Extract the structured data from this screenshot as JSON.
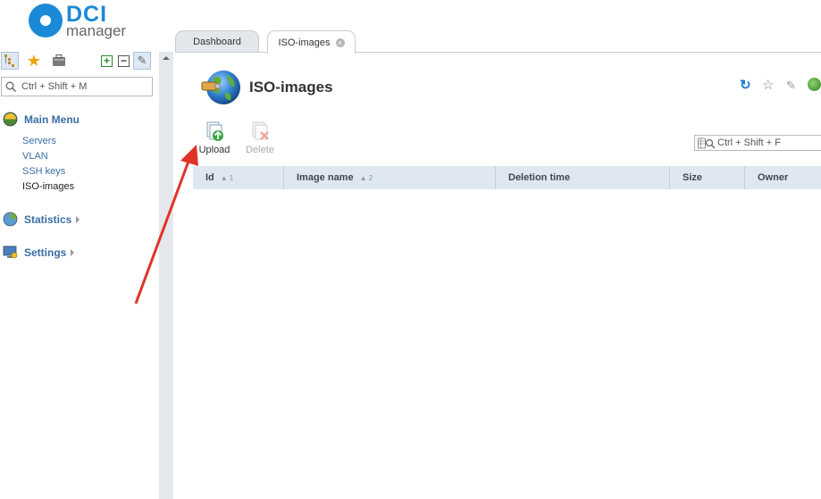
{
  "logo": {
    "brand": "DCI",
    "product": "manager"
  },
  "left_panel": {
    "search_placeholder": "Ctrl + Shift + M",
    "main_menu": {
      "label": "Main Menu",
      "items": [
        "Servers",
        "VLAN",
        "SSH keys",
        "ISO-images"
      ]
    },
    "statistics_label": "Statistics",
    "settings_label": "Settings"
  },
  "tabs": [
    {
      "label": "Dashboard"
    },
    {
      "label": "ISO-images"
    }
  ],
  "page": {
    "title": "ISO-images"
  },
  "toolbar": {
    "upload_label": "Upload",
    "delete_label": "Delete"
  },
  "table": {
    "search_placeholder": "Ctrl + Shift + F",
    "columns": [
      {
        "label": "Id",
        "sort": "▲ 1"
      },
      {
        "label": "Image name",
        "sort": "▲ 2"
      },
      {
        "label": "Deletion time",
        "sort": ""
      },
      {
        "label": "Size",
        "sort": ""
      },
      {
        "label": "Owner",
        "sort": ""
      }
    ]
  },
  "colors": {
    "accent": "#1a8ad6",
    "menu_link": "#3b6ea5",
    "annotation_arrow": "#e0342a"
  }
}
